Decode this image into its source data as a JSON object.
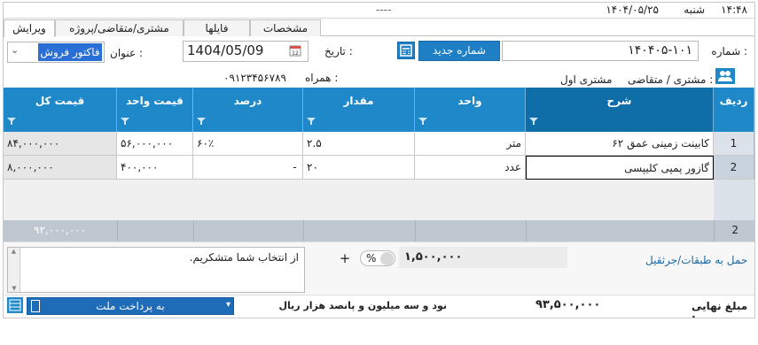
{
  "topbar": {
    "time": "۱۴:۴۸",
    "day": "شنبه",
    "date": "۱۴۰۴/۰۵/۲۵",
    "dashes": "----"
  },
  "tabs": [
    {
      "label": "ویرایش",
      "active": true
    },
    {
      "label": "مشتری/متقاضی/پروژه",
      "active": false
    },
    {
      "label": "فایلها",
      "active": false
    },
    {
      "label": "مشخصات",
      "active": false
    }
  ],
  "header": {
    "number_label": "شماره :",
    "number_value": "۱۴۰۴۰۵-۱۰۱",
    "new_number_button": "شماره جدید",
    "date_label": "تاریخ :",
    "date_value": "1404/05/09",
    "title_label": "عنوان :",
    "title_value": "فاکتور فروش",
    "customer_label": "مشتری / متقاضی :",
    "customer_value": "مشتری اول",
    "mobile_label": "همراه :",
    "mobile_value": "۰۹۱۲۳۴۵۶۷۸۹"
  },
  "grid": {
    "columns": [
      "ردیف",
      "شرح",
      "واحد",
      "مقدار",
      "درصد",
      "قیمت واحد",
      "قیمت کل"
    ],
    "rows": [
      {
        "index": "1",
        "description": "کابینت زمینی عمق ۶۲",
        "unit": "متر",
        "quantity": "۲.۵",
        "percent": "۶۰٪",
        "unit_price": "۵۶,۰۰۰,۰۰۰",
        "total": "۸۴,۰۰۰,۰۰۰"
      },
      {
        "index": "2",
        "description": "گازور پمپی کلیپسی",
        "unit": "عدد",
        "quantity": "۲۰",
        "percent": "-",
        "unit_price": "۴۰۰,۰۰۰",
        "total": "۸,۰۰۰,۰۰۰"
      }
    ],
    "footer_count": "2",
    "footer_total": "۹۲,۰۰۰,۰۰۰"
  },
  "bottom": {
    "note": "از انتخاب شما متشکریم.",
    "shipping_label": "حمل به طبقات/جرثقیل",
    "shipping_amount": "۱,۵۰۰,۰۰۰",
    "percent_symbol": "%",
    "plus_symbol": "+",
    "final_label": "مبلغ نهایی :",
    "final_amount": "۹۳,۵۰۰,۰۰۰",
    "amount_words": "نود و سه میلیون و پانصد  هزار  ریال",
    "payment_method": "به پرداخت ملت"
  },
  "colors": {
    "accent": "#1e88c8",
    "accent_dark": "#0f6ea8",
    "grid_footer": "#bfc7d0"
  }
}
